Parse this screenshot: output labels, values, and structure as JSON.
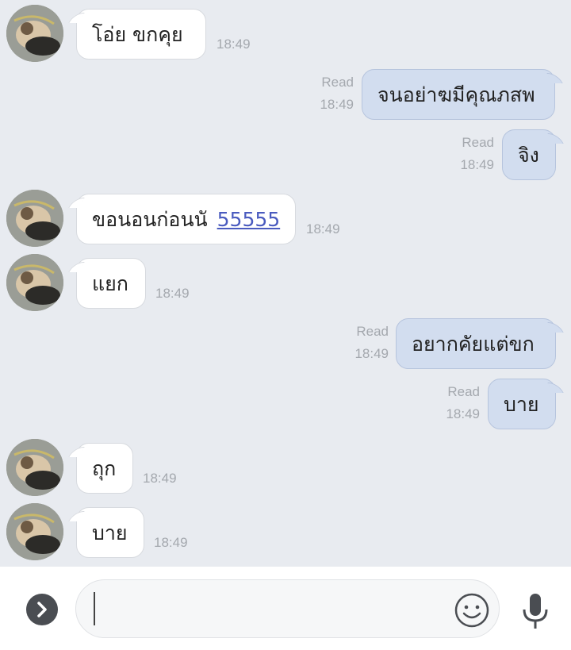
{
  "messages": [
    {
      "side": "in",
      "text": "โอ่ย ขกคุย",
      "time": "18:49"
    },
    {
      "side": "out",
      "text": "จนอย่าฆมีคุณภสพ",
      "status": "Read",
      "time": "18:49"
    },
    {
      "side": "out",
      "text": "จิง",
      "status": "Read",
      "time": "18:49"
    },
    {
      "side": "in",
      "text": "ขอนอนก่อนนั",
      "link": "55555",
      "time": "18:49"
    },
    {
      "side": "in",
      "text": "แยก",
      "time": "18:49"
    },
    {
      "side": "out",
      "text": "อยากคัยแต่ขก",
      "status": "Read",
      "time": "18:49"
    },
    {
      "side": "out",
      "text": "บาย",
      "status": "Read",
      "time": "18:49"
    },
    {
      "side": "in",
      "text": "ถุก",
      "time": "18:49"
    },
    {
      "side": "in",
      "text": "บาย",
      "time": "18:49"
    }
  ],
  "composer": {
    "expand_icon": "chevron-right-icon",
    "emoji_icon": "smiley-icon",
    "mic_icon": "microphone-icon"
  },
  "colors": {
    "background": "#e8ebf0",
    "incoming_bubble": "#ffffff",
    "outgoing_bubble": "#d2ddef",
    "timestamp": "#a4a8ae",
    "link": "#4a5bbf"
  }
}
